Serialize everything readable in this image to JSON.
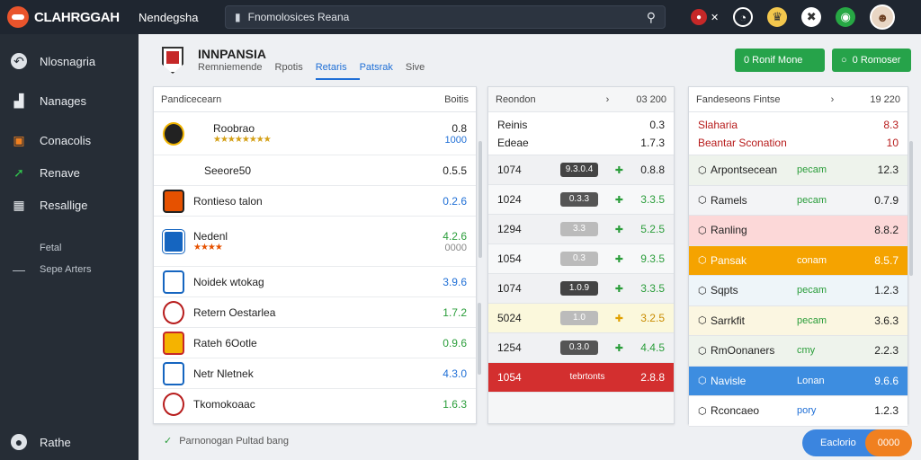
{
  "app": {
    "logo": "CLAHRGGAH",
    "nav_title": "Nendegsha"
  },
  "search": {
    "text": "Fnomolosices Reana"
  },
  "top_icons": [
    "flag-icon",
    "search-icon",
    "trophy-icon",
    "globe-icon",
    "clock-icon",
    "user-avatar"
  ],
  "sidebar": {
    "items": [
      {
        "label": "Nlosnagria",
        "icon": "back-arrow-icon"
      },
      {
        "label": "Nanages",
        "icon": "chart-icon"
      },
      {
        "label": "Conacolis",
        "icon": "calendar-icon"
      },
      {
        "label": "Renave",
        "icon": "trend-icon"
      },
      {
        "label": "Resallige",
        "icon": "grid-icon"
      }
    ],
    "section_label": "Fetal",
    "sub_item": "Sepe Arters",
    "footer": "Rathe"
  },
  "header": {
    "title": "INNPANSIA",
    "tabs": [
      "Remniemende",
      "Rpotis",
      "Retaris",
      "Patsrak",
      "Sive"
    ],
    "btn1": "0 Ronif Mone",
    "btn2": "0 Romoser"
  },
  "panel1": {
    "header_left": "Pandicecearn",
    "header_right": "Boitis",
    "rows": [
      {
        "name": "Roobrao",
        "val": "0.8",
        "sub": "1000",
        "stars": "★★★★★★★★"
      },
      {
        "name": "Seeore50",
        "val": "0.5.5"
      },
      {
        "name": "Rontieso talon",
        "val": "0.2.6"
      },
      {
        "name": "Nedenl",
        "val": "4.2.6",
        "sub": "0000",
        "stars": "★★★★"
      },
      {
        "name": "Noidek wtokag",
        "val": "3.9.6"
      },
      {
        "name": "Retern Oestarlea",
        "val": "1.7.2"
      },
      {
        "name": "Rateh 6Ootle",
        "val": "0.9.6"
      },
      {
        "name": "Netr Nletnek",
        "val": "4.3.0"
      },
      {
        "name": "Tkomokoaac",
        "val": "1.6.3"
      }
    ]
  },
  "panel2": {
    "header_left": "Reondon",
    "header_right": "03 200",
    "top": [
      {
        "name": "Reinis",
        "val": "0.3"
      },
      {
        "name": "Edeae",
        "val": "1.7.3"
      }
    ],
    "rows": [
      {
        "left": "1074",
        "pill": "9.3.0.4",
        "right": "0.8.8"
      },
      {
        "left": "1024",
        "pill": "0.3.3",
        "right": "3.3.5"
      },
      {
        "left": "1294",
        "pill": "3.3",
        "right": "5.2.5"
      },
      {
        "left": "1054",
        "pill": "0.3",
        "right": "9.3.5"
      },
      {
        "left": "1074",
        "pill": "1.0.9",
        "right": "3.3.5"
      },
      {
        "left": "5024",
        "pill": "1.0",
        "right": "3.2.5"
      },
      {
        "left": "1254",
        "pill": "0.3.0",
        "right": "4.4.5"
      },
      {
        "left": "1054",
        "pill": "tebrtonts",
        "right": "2.8.8"
      }
    ]
  },
  "panel3": {
    "header_left": "Fandeseons Fintse",
    "header_right": "19 220",
    "top": [
      {
        "name": "Slaharia",
        "val": "8.3"
      },
      {
        "name": "Beantar Sconation",
        "val": "10"
      }
    ],
    "rows": [
      {
        "name": "Arpontsecean",
        "mid": "pecam",
        "val": "12.3"
      },
      {
        "name": "Ramels",
        "mid": "pecam",
        "val": "0.7.9"
      },
      {
        "name": "Ranling",
        "mid": "",
        "val": "8.8.2"
      },
      {
        "name": "Pansak",
        "mid": "conam",
        "val": "8.5.7"
      },
      {
        "name": "Sqpts",
        "mid": "pecam",
        "val": "1.2.3"
      },
      {
        "name": "Sarrkfit",
        "mid": "pecam",
        "val": "3.6.3"
      },
      {
        "name": "RmOonaners",
        "mid": "cmy",
        "val": "2.2.3"
      },
      {
        "name": "Navisle",
        "mid": "Lonan",
        "val": "9.6.6"
      },
      {
        "name": "Rconcaeo",
        "mid": "pory",
        "val": "1.2.3"
      }
    ]
  },
  "status": {
    "text": "Parnonogan Pultad bang"
  },
  "fab": {
    "label": "Eaclorio",
    "badge": "0000"
  },
  "colors": {
    "green": "#26a34a",
    "orange": "#f5a300",
    "blue": "#3d8de0",
    "red": "#d32f2f"
  }
}
